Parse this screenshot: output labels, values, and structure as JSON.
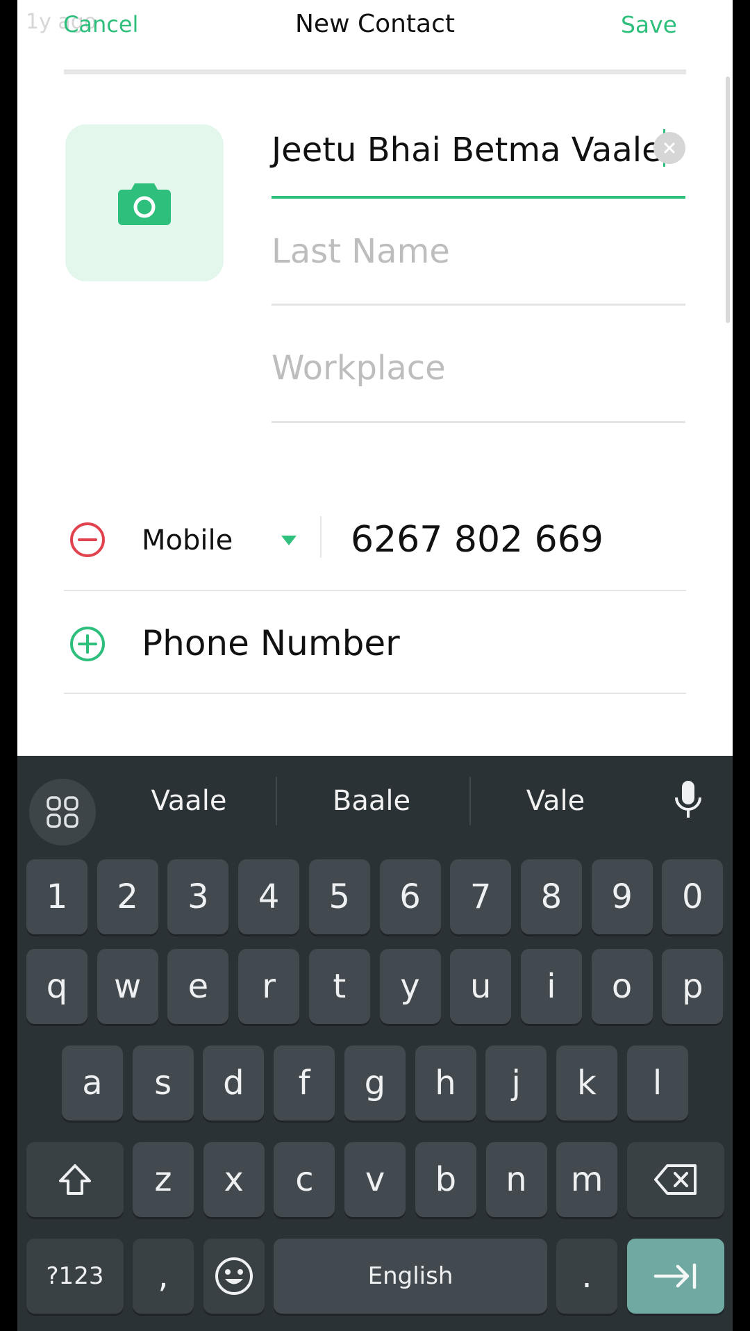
{
  "header": {
    "ghost_text": "1y ago",
    "cancel_label": "Cancel",
    "title": "New Contact",
    "save_label": "Save"
  },
  "form": {
    "first_name_value": "Jeetu Bhai Betma Vaale",
    "last_name_placeholder": "Last Name",
    "workplace_placeholder": "Workplace"
  },
  "phones": [
    {
      "type": "Mobile",
      "number": "6267 802 669"
    }
  ],
  "add_phone_label": "Phone Number",
  "keyboard": {
    "suggestions": [
      "Vaale",
      "Baale",
      "Vale"
    ],
    "row_numbers": [
      "1",
      "2",
      "3",
      "4",
      "5",
      "6",
      "7",
      "8",
      "9",
      "0"
    ],
    "row_q": [
      "q",
      "w",
      "e",
      "r",
      "t",
      "y",
      "u",
      "i",
      "o",
      "p"
    ],
    "row_a": [
      "a",
      "s",
      "d",
      "f",
      "g",
      "h",
      "j",
      "k",
      "l"
    ],
    "row_z": [
      "z",
      "x",
      "c",
      "v",
      "b",
      "n",
      "m"
    ],
    "symbols_label": "?123",
    "comma_label": ",",
    "space_label": "English",
    "period_label": "."
  },
  "colors": {
    "accent": "#2fbf7d",
    "remove": "#e0424e",
    "keyboard_bg": "#2b3236",
    "key_bg": "#434a4f",
    "enter_key": "#6fa9a1"
  }
}
